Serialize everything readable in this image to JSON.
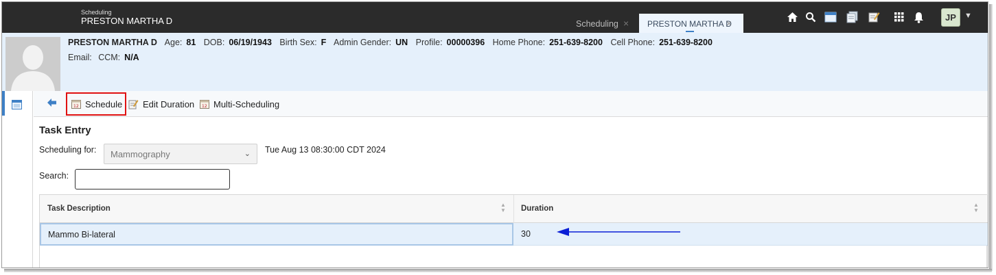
{
  "app": {
    "module_label": "Scheduling",
    "window_title": "PRESTON MARTHA D"
  },
  "tabs": [
    {
      "label": "Scheduling",
      "active": false,
      "close": "×"
    },
    {
      "label": "PRESTON MARTHA D",
      "active": true,
      "close": "×"
    }
  ],
  "topbar": {
    "icons": [
      "home-icon",
      "search-icon",
      "calendar-window-icon",
      "documents-icon",
      "notes-icon",
      "apps-grid-icon",
      "bell-icon"
    ],
    "user_initials": "JP"
  },
  "patient": {
    "name": "PRESTON MARTHA D",
    "fields": [
      {
        "label": "Age:",
        "value": "81"
      },
      {
        "label": "DOB:",
        "value": "06/19/1943"
      },
      {
        "label": "Birth Sex:",
        "value": "F"
      },
      {
        "label": "Admin Gender:",
        "value": "UN"
      },
      {
        "label": "Profile:",
        "value": "00000396"
      },
      {
        "label": "Home Phone:",
        "value": "251-639-8200"
      },
      {
        "label": "Cell Phone:",
        "value": "251-639-8200"
      }
    ],
    "email_label": "Email:",
    "ccm_label": "CCM:",
    "ccm_value": "N/A"
  },
  "toolbar": {
    "schedule_label": "Schedule",
    "edit_duration_label": "Edit Duration",
    "multi_scheduling_label": "Multi-Scheduling"
  },
  "task_entry": {
    "title": "Task Entry",
    "scheduling_for_label": "Scheduling for:",
    "scheduling_for_value": "Mammography",
    "datetime": "Tue Aug 13 08:30:00 CDT 2024",
    "search_label": "Search:",
    "search_value": ""
  },
  "grid": {
    "columns": [
      "Task Description",
      "Duration"
    ],
    "rows": [
      {
        "description": "Mammo Bi-lateral",
        "duration": "30",
        "selected": true
      }
    ]
  },
  "colors": {
    "topbar": "#2b2b2b",
    "banner": "#e5f0fb",
    "accent": "#3e80c6",
    "highlight_box": "#e01010",
    "annotation_arrow": "#0a1ed6"
  }
}
